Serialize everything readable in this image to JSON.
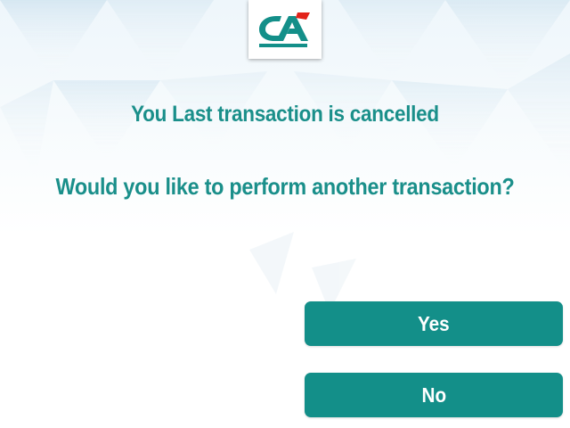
{
  "brand": {
    "logo_icon": "credit-agricole-logo",
    "logo_text": "CA",
    "colors": {
      "primary": "#138f89",
      "accent": "#e2231a"
    }
  },
  "screen": {
    "title": "You Last transaction is cancelled",
    "question": "Would you like to perform another transaction?"
  },
  "buttons": {
    "yes_label": "Yes",
    "no_label": "No"
  }
}
